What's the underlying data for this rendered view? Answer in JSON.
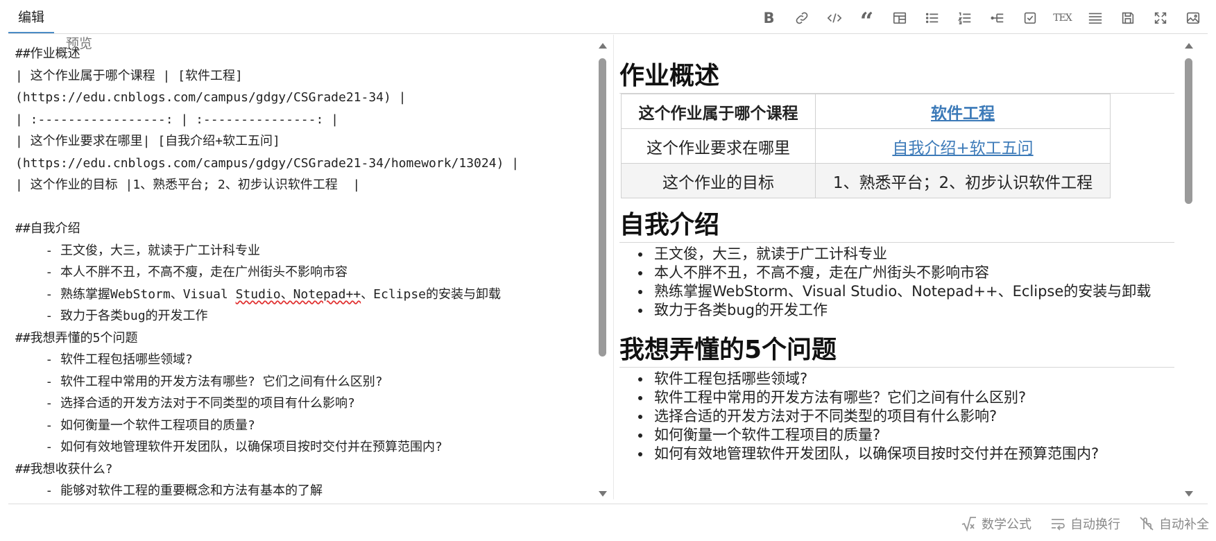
{
  "tabs": {
    "edit": "编辑",
    "preview": "预览"
  },
  "toolbar": {
    "tex_label": "TEX",
    "icons": [
      "bold-icon",
      "link-icon",
      "code-icon",
      "quote-icon",
      "table-icon",
      "unordered-list-icon",
      "ordered-list-icon",
      "outline-icon",
      "checkbox-icon",
      "tex-icon",
      "justify-icon",
      "save-icon",
      "fullscreen-icon",
      "image-icon"
    ]
  },
  "editor": {
    "lines": [
      "##作业概述",
      "| 这个作业属于哪个课程 | [软件工程]",
      "(https://edu.cnblogs.com/campus/gdgy/CSGrade21-34) |",
      "| :-----------------: | :---------------: |",
      "| 这个作业要求在哪里| [自我介绍+软工五问]",
      "(https://edu.cnblogs.com/campus/gdgy/CSGrade21-34/homework/13024) |",
      "| 这个作业的目标 |1、熟悉平台; 2、初步认识软件工程  |",
      "",
      "##自我介绍",
      "    - 王文俊，大三，就读于广工计科专业",
      "    - 本人不胖不丑，不高不瘦，走在广州街头不影响市容",
      "    - 熟练掌握WebStorm、Visual Studio、Notepad++、Eclipse的安装与卸载",
      "    - 致力于各类bug的开发工作",
      "##我想弄懂的5个问题",
      "    - 软件工程包括哪些领域?",
      "    - 软件工程中常用的开发方法有哪些? 它们之间有什么区别?",
      "    - 选择合适的开发方法对于不同类型的项目有什么影响?",
      "    - 如何衡量一个软件工程项目的质量?",
      "    - 如何有效地管理软件开发团队，以确保项目按时交付并在预算范围内?",
      "##我想收获什么?",
      "    - 能够对软件工程的重要概念和方法有基本的了解"
    ]
  },
  "preview": {
    "h_overview": "作业概述",
    "table": {
      "r1": {
        "label": "这个作业属于哪个课程",
        "value": "软件工程"
      },
      "r2": {
        "label": "这个作业要求在哪里",
        "value": "自我介绍+软工五问"
      },
      "r3": {
        "label": "这个作业的目标",
        "value": "1、熟悉平台；2、初步认识软件工程"
      }
    },
    "h_intro": "自我介绍",
    "intro_items": [
      "王文俊，大三，就读于广工计科专业",
      "本人不胖不丑，不高不瘦，走在广州街头不影响市容",
      "熟练掌握WebStorm、Visual Studio、Notepad++、Eclipse的安装与卸载",
      "致力于各类bug的开发工作"
    ],
    "h_questions": "我想弄懂的5个问题",
    "question_items": [
      "软件工程包括哪些领域?",
      "软件工程中常用的开发方法有哪些？它们之间有什么区别?",
      "选择合适的开发方法对于不同类型的项目有什么影响?",
      "如何衡量一个软件工程项目的质量?",
      "如何有效地管理软件开发团队，以确保项目按时交付并在预算范围内?"
    ]
  },
  "status": {
    "math": "数学公式",
    "wrap": "自动换行",
    "complete": "自动补全"
  },
  "colors": {
    "accent": "#4a8bc6",
    "link": "#3c7ab8",
    "spell_error": "#e03030"
  }
}
